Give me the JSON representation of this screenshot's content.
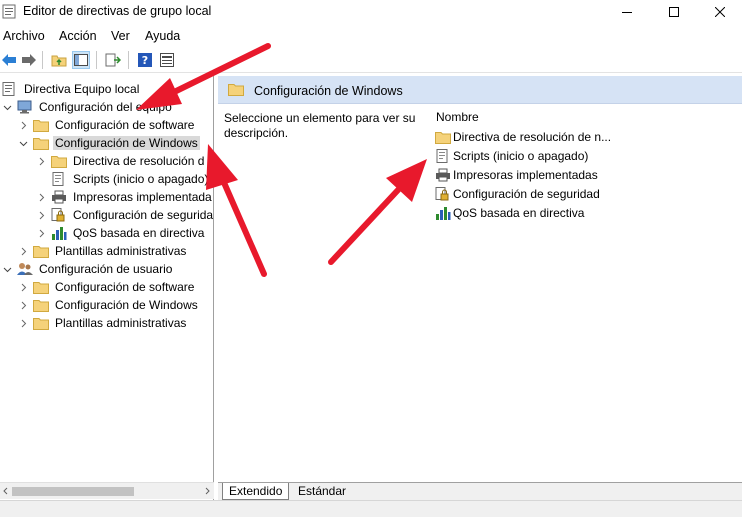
{
  "window": {
    "title": "Editor de directivas de grupo local",
    "controls": [
      "minimize",
      "maximize",
      "close"
    ]
  },
  "menu": [
    "Archivo",
    "Acción",
    "Ver",
    "Ayuda"
  ],
  "toolbar": {
    "buttons": [
      "back-icon",
      "forward-icon",
      "up-folder-icon",
      "show-hide-tree-icon",
      "export-list-icon",
      "help-icon",
      "properties-icon"
    ]
  },
  "tree": {
    "items": [
      {
        "label": "Directiva Equipo local",
        "icon": "policy-doc-icon"
      },
      {
        "label": "Configuración del equipo",
        "icon": "computer-icon"
      },
      {
        "label": "Configuración de software",
        "icon": "folder-icon"
      },
      {
        "label": "Configuración de Windows",
        "icon": "folder-open-icon"
      },
      {
        "label": "Directiva de resolución d",
        "icon": "folder-icon"
      },
      {
        "label": "Scripts (inicio o apagado)",
        "icon": "script-icon"
      },
      {
        "label": "Impresoras implementada",
        "icon": "printer-icon"
      },
      {
        "label": "Configuración de segurida",
        "icon": "security-icon"
      },
      {
        "label": "QoS basada en directiva",
        "icon": "chart-icon"
      },
      {
        "label": "Plantillas administrativas",
        "icon": "folder-icon"
      },
      {
        "label": "Configuración de usuario",
        "icon": "users-icon"
      },
      {
        "label": "Configuración de software",
        "icon": "folder-icon"
      },
      {
        "label": "Configuración de Windows",
        "icon": "folder-icon"
      },
      {
        "label": "Plantillas administrativas",
        "icon": "folder-icon"
      }
    ]
  },
  "details": {
    "header": "Configuración de Windows",
    "description": "Seleccione un elemento para ver su descripción.",
    "column_name": "Nombre",
    "items": [
      {
        "label": "Directiva de resolución de n...",
        "icon": "folder-icon"
      },
      {
        "label": "Scripts (inicio o apagado)",
        "icon": "script-icon"
      },
      {
        "label": "Impresoras implementadas",
        "icon": "printer-icon"
      },
      {
        "label": "Configuración de seguridad",
        "icon": "security-icon"
      },
      {
        "label": "QoS basada en directiva",
        "icon": "chart-icon"
      }
    ]
  },
  "tabs": [
    "Extendido",
    "Estándar"
  ],
  "colors": {
    "header_bg": "#d6e3f5",
    "selection_bg": "#d9d9d9",
    "annotation_arrow": "#e8192c",
    "folder": "#f5d27a"
  }
}
